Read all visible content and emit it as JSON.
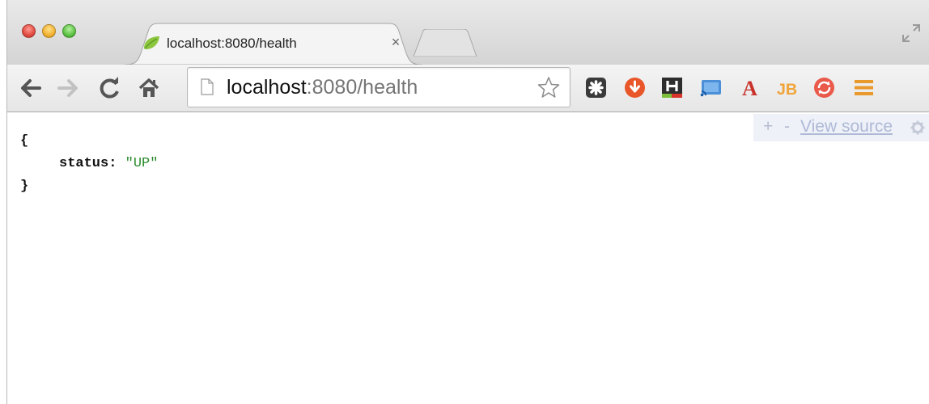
{
  "window": {
    "buttons": [
      "close",
      "minimize",
      "maximize"
    ]
  },
  "tab": {
    "title": "localhost:8080/health",
    "close_label": "×",
    "favicon": "spring-leaf-icon"
  },
  "toolbar": {
    "url_host": "localhost",
    "url_rest": ":8080/health",
    "extensions": [
      "puzzle-extension-icon",
      "download-extension-icon",
      "h-extension-icon",
      "cast-extension-icon",
      "font-extension-icon",
      "jb-extension-icon",
      "sync-extension-icon",
      "menu-icon"
    ]
  },
  "content": {
    "open_brace": "{",
    "key": "status:",
    "value": "\"UP\"",
    "close_brace": "}"
  },
  "view_source": {
    "plus": "+",
    "minus": "-",
    "link": "View source"
  },
  "colors": {
    "json_string": "#2a8a2a",
    "link": "#aeb9d6"
  }
}
